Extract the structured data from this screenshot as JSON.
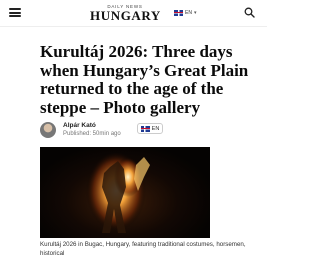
{
  "header": {
    "logo_small": "DAILY NEWS",
    "logo_big": "HUNGARY",
    "language": "EN",
    "menu_icon": "hamburger-menu-icon",
    "search_icon": "search-icon"
  },
  "article": {
    "title": "Kurultáj 2026: Three days when Hungary’s Great Plain returned to the age of the steppe – Photo gallery",
    "author": "Alpár Kató",
    "published": "Published: 50min ago",
    "language_button": "EN",
    "image_alt_icon": "fire-dancer-photo",
    "caption": "Kurultáj 2026 in Bugac, Hungary, featuring traditional costumes, horsemen, historical"
  },
  "colors": {
    "flag_blue": "#1f3a93",
    "flag_red": "#c8102e",
    "fire": "#f3a23a"
  }
}
